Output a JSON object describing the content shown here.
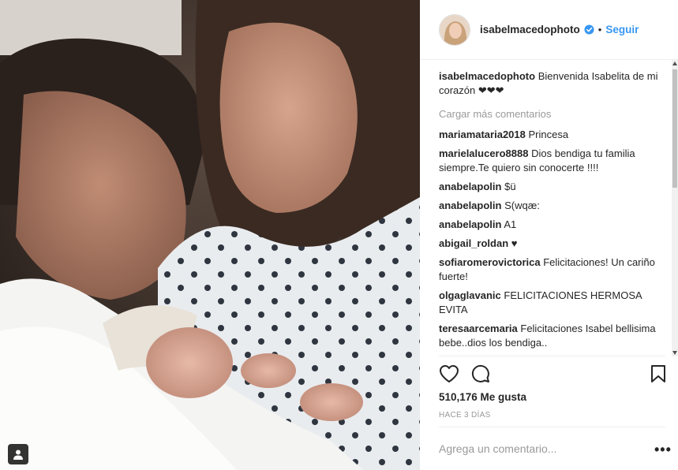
{
  "post": {
    "username": "isabelmacedophoto",
    "follow_label": "Seguir",
    "separator": "•",
    "caption": {
      "user": "isabelmacedophoto",
      "text": "Bienvenida Isabelita de mi corazón ❤❤❤"
    },
    "load_more_label": "Cargar más comentarios",
    "comments": [
      {
        "user": "mariamataria2018",
        "text": "Princesa"
      },
      {
        "user": "marielalucero8888",
        "text": "Dios bendiga tu familia siempre.Te quiero sin conocerte !!!!"
      },
      {
        "user": "anabelapolin",
        "text": "$ü"
      },
      {
        "user": "anabelapolin",
        "text": "S(wqæ:"
      },
      {
        "user": "anabelapolin",
        "text": "A1"
      },
      {
        "user": "abigail_roldan",
        "text": "♥"
      },
      {
        "user": "sofiaromerovictorica",
        "text": "Felicitaciones! Un cariño fuerte!"
      },
      {
        "user": "olgaglavanic",
        "text": "FELICITACIONES HERMOSA EVITA"
      },
      {
        "user": "teresaarcemaria",
        "text": "Felicitaciones Isabel bellisima bebe..dios los bendiga.."
      },
      {
        "user": "",
        "text": ""
      }
    ],
    "likes_label": "510,176 Me gusta",
    "time_label": "HACE 3 DÍAS",
    "add_comment_placeholder": "Agrega un comentario...",
    "more_options": "•••"
  },
  "icons": {
    "heart": "heart-icon",
    "comment": "comment-icon",
    "bookmark": "bookmark-icon",
    "verified": "verified-badge-icon",
    "user_tag": "user-tag-icon"
  },
  "colors": {
    "link_blue": "#3897f0",
    "text": "#262626",
    "muted": "#999999",
    "divider": "#efefef"
  }
}
